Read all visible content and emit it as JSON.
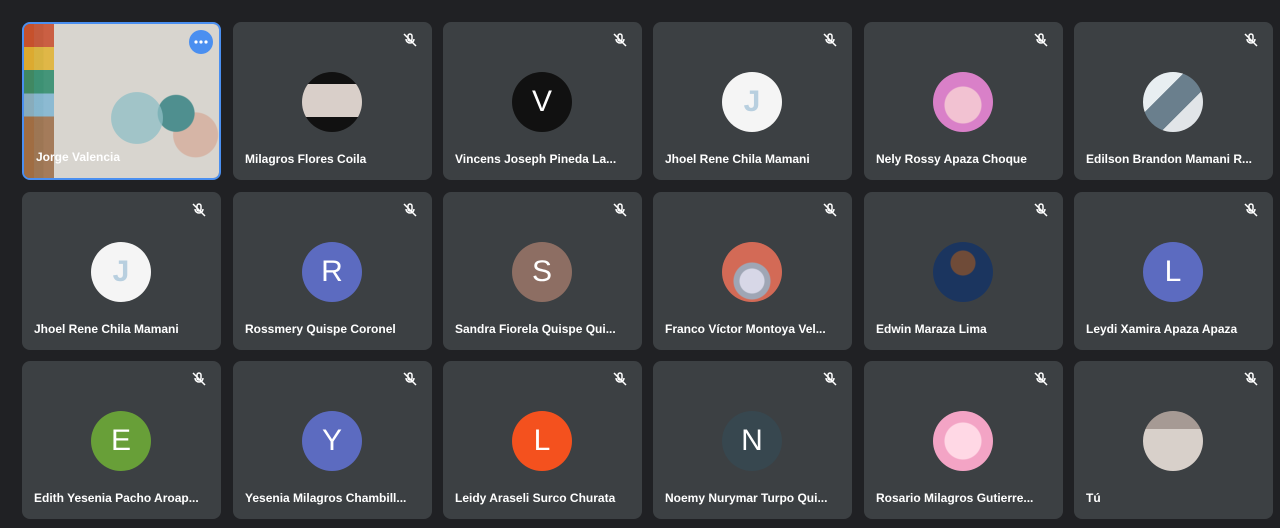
{
  "participants": [
    {
      "name": "Jorge Valencia",
      "initial": ""
    },
    {
      "name": "Milagros Flores Coila",
      "initial": ""
    },
    {
      "name": "Vincens Joseph Pineda La...",
      "initial": "V",
      "color": "#111111"
    },
    {
      "name": "Jhoel Rene Chila Mamani",
      "initial": ""
    },
    {
      "name": "Nely Rossy Apaza Choque",
      "initial": ""
    },
    {
      "name": "Edilson Brandon Mamani R...",
      "initial": ""
    },
    {
      "name": "Jhoel Rene Chila Mamani",
      "initial": ""
    },
    {
      "name": "Rossmery Quispe Coronel",
      "initial": "R",
      "color": "#5c6bc0"
    },
    {
      "name": "Sandra Fiorela Quispe Qui...",
      "initial": "S",
      "color": "#8d6e63"
    },
    {
      "name": "Franco Víctor Montoya Vel...",
      "initial": ""
    },
    {
      "name": "Edwin Maraza Lima",
      "initial": ""
    },
    {
      "name": "Leydi Xamira Apaza Apaza",
      "initial": "L",
      "color": "#5c6bc0"
    },
    {
      "name": "Edith Yesenia Pacho Aroap...",
      "initial": "E",
      "color": "#689f38"
    },
    {
      "name": "Yesenia Milagros Chambill...",
      "initial": "Y",
      "color": "#5c6bc0"
    },
    {
      "name": "Leidy Araseli Surco Churata",
      "initial": "L",
      "color": "#f4511e"
    },
    {
      "name": "Noemy Nurymar Turpo Qui...",
      "initial": "N",
      "color": "#37474f"
    },
    {
      "name": "Rosario Milagros Gutierre...",
      "initial": ""
    },
    {
      "name": "Tú",
      "initial": ""
    }
  ],
  "icons": {
    "mic_muted": "mic-off-icon",
    "more_options": "more-options-icon"
  }
}
